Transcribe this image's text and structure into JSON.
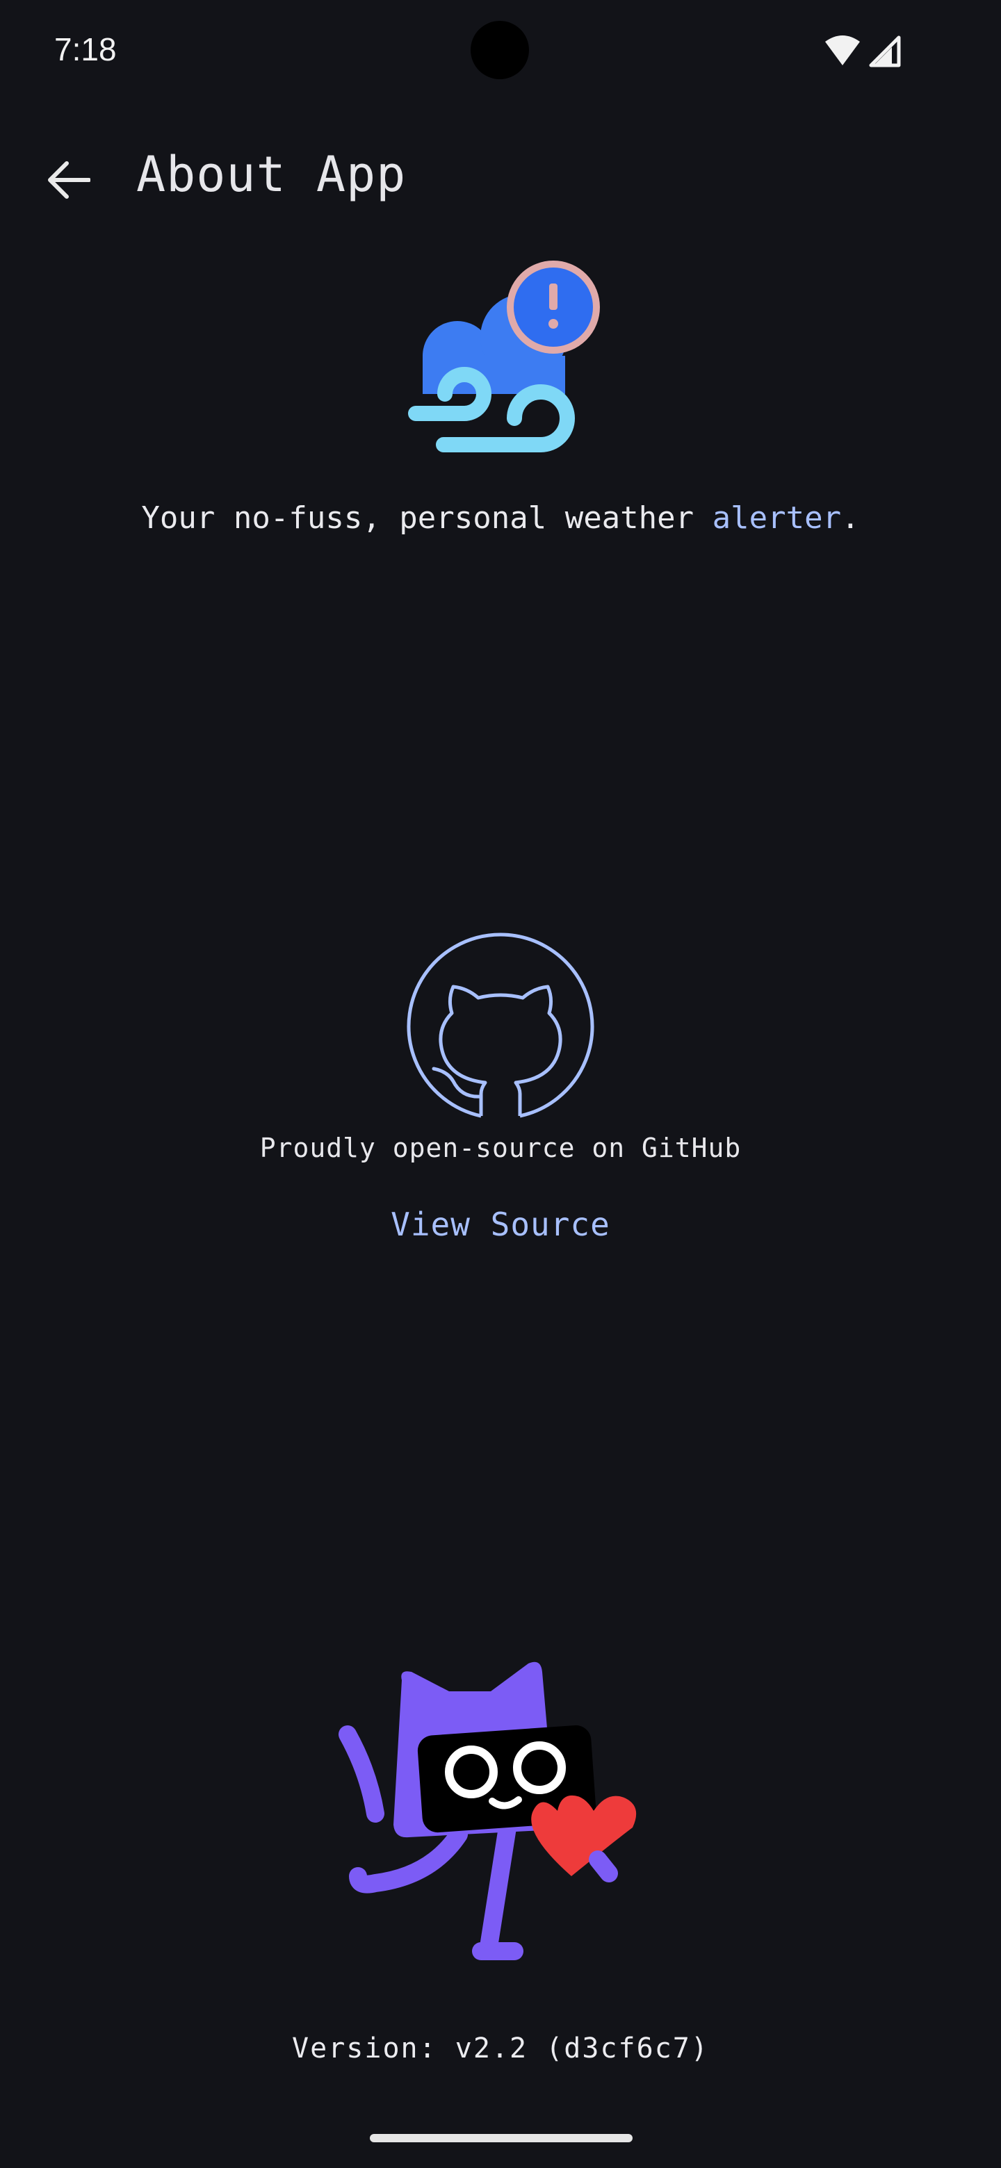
{
  "status_bar": {
    "time": "7:18",
    "wifi_icon": "wifi-icon",
    "signal_icon": "cell-signal-icon"
  },
  "app_bar": {
    "title": "About App",
    "back_icon": "arrow-back-icon"
  },
  "hero": {
    "logo_icon": "wind-cloud-alert-icon",
    "tagline_prefix": "Your no-fuss, personal weather ",
    "tagline_accent": "alerter",
    "tagline_suffix": "."
  },
  "github": {
    "icon": "github-octocat-icon",
    "caption": "Proudly open-source on GitHub",
    "link_label": "View Source"
  },
  "footer": {
    "mascot": "purple-cat-mascot-with-heart",
    "version": "Version: v2.2 (d3cf6c7)"
  },
  "colors": {
    "background": "#121318",
    "accent": "#a8c0ff",
    "cloud_blue": "#3d7cf2",
    "wind_cyan": "#7fd8f6",
    "mascot_purple": "#7c5cf5",
    "heart_red": "#ee3b3b"
  }
}
